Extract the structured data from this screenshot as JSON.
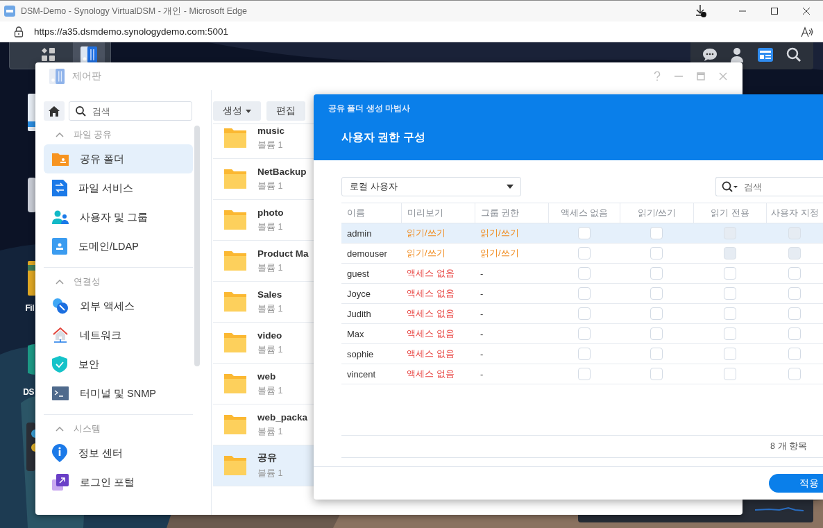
{
  "browser": {
    "title": "DSM-Demo - Synology VirtualDSM - 개인 - Microsoft Edge",
    "url": "https://a35.dsmdemo.synologydemo.com:5001"
  },
  "desktop": {
    "icon_labels": [
      "Fil",
      "DS"
    ]
  },
  "control_panel": {
    "title": "제어판",
    "search_placeholder": "검색",
    "sections": [
      {
        "title": "파일 공유",
        "expanded": true,
        "items": [
          {
            "label": "공유 폴더",
            "selected": true
          },
          {
            "label": "파일 서비스",
            "selected": false
          },
          {
            "label": "사용자 및 그룹",
            "selected": false
          },
          {
            "label": "도메인/LDAP",
            "selected": false
          }
        ]
      },
      {
        "title": "연결성",
        "expanded": true,
        "items": [
          {
            "label": "외부 액세스",
            "selected": false
          },
          {
            "label": "네트워크",
            "selected": false
          },
          {
            "label": "보안",
            "selected": false
          },
          {
            "label": "터미널 및 SNMP",
            "selected": false
          }
        ]
      },
      {
        "title": "시스템",
        "expanded": true,
        "items": [
          {
            "label": "정보 센터",
            "selected": false
          },
          {
            "label": "로그인 포털",
            "selected": false
          }
        ]
      }
    ],
    "toolbar": [
      {
        "label": "생성",
        "dropdown": true
      },
      {
        "label": "편집",
        "dropdown": false
      }
    ],
    "folders": [
      {
        "name": "music",
        "volume": "볼륨 1",
        "selected": false
      },
      {
        "name": "NetBackup",
        "volume": "볼륨 1",
        "selected": false
      },
      {
        "name": "photo",
        "volume": "볼륨 1",
        "selected": false
      },
      {
        "name": "Product Ma",
        "volume": "볼륨 1",
        "selected": false
      },
      {
        "name": "Sales",
        "volume": "볼륨 1",
        "selected": false
      },
      {
        "name": "video",
        "volume": "볼륨 1",
        "selected": false
      },
      {
        "name": "web",
        "volume": "볼륨 1",
        "selected": false
      },
      {
        "name": "web_packa",
        "volume": "볼륨 1",
        "selected": false
      },
      {
        "name": "공유",
        "volume": "볼륨 1",
        "selected": true
      }
    ]
  },
  "wizard": {
    "title": "공유 폴더 생성 마법사",
    "heading": "사용자 권한 구성",
    "user_type": "로컬 사용자",
    "search_placeholder": "검색",
    "columns": [
      "이름",
      "미리보기",
      "그룹 권한",
      "액세스 없음",
      "읽기/쓰기",
      "읽기 전용",
      "사용자 지정"
    ],
    "rows": [
      {
        "name": "admin",
        "selected": true,
        "preview": {
          "text": "읽기/쓰기",
          "kind": "read_write"
        },
        "group": {
          "text": "읽기/쓰기",
          "kind": "read_write"
        },
        "checks": [
          {
            "checked": false,
            "disabled": false
          },
          {
            "checked": false,
            "disabled": false
          },
          {
            "checked": false,
            "disabled": true
          },
          {
            "checked": false,
            "disabled": true
          }
        ]
      },
      {
        "name": "demouser",
        "selected": false,
        "preview": {
          "text": "읽기/쓰기",
          "kind": "read_write"
        },
        "group": {
          "text": "읽기/쓰기",
          "kind": "read_write"
        },
        "checks": [
          {
            "checked": false,
            "disabled": false
          },
          {
            "checked": false,
            "disabled": false
          },
          {
            "checked": false,
            "disabled": true
          },
          {
            "checked": false,
            "disabled": true
          }
        ]
      },
      {
        "name": "guest",
        "selected": false,
        "preview": {
          "text": "액세스 없음",
          "kind": "no_access"
        },
        "group": {
          "text": "-",
          "kind": "plain"
        },
        "checks": [
          {
            "checked": false,
            "disabled": false
          },
          {
            "checked": false,
            "disabled": false
          },
          {
            "checked": false,
            "disabled": false
          },
          {
            "checked": false,
            "disabled": false
          }
        ]
      },
      {
        "name": "Joyce",
        "selected": false,
        "preview": {
          "text": "액세스 없음",
          "kind": "no_access"
        },
        "group": {
          "text": "-",
          "kind": "plain"
        },
        "checks": [
          {
            "checked": false,
            "disabled": false
          },
          {
            "checked": false,
            "disabled": false
          },
          {
            "checked": false,
            "disabled": false
          },
          {
            "checked": false,
            "disabled": false
          }
        ]
      },
      {
        "name": "Judith",
        "selected": false,
        "preview": {
          "text": "액세스 없음",
          "kind": "no_access"
        },
        "group": {
          "text": "-",
          "kind": "plain"
        },
        "checks": [
          {
            "checked": false,
            "disabled": false
          },
          {
            "checked": false,
            "disabled": false
          },
          {
            "checked": false,
            "disabled": false
          },
          {
            "checked": false,
            "disabled": false
          }
        ]
      },
      {
        "name": "Max",
        "selected": false,
        "preview": {
          "text": "액세스 없음",
          "kind": "no_access"
        },
        "group": {
          "text": "-",
          "kind": "plain"
        },
        "checks": [
          {
            "checked": false,
            "disabled": false
          },
          {
            "checked": false,
            "disabled": false
          },
          {
            "checked": false,
            "disabled": false
          },
          {
            "checked": false,
            "disabled": false
          }
        ]
      },
      {
        "name": "sophie",
        "selected": false,
        "preview": {
          "text": "액세스 없음",
          "kind": "no_access"
        },
        "group": {
          "text": "-",
          "kind": "plain"
        },
        "checks": [
          {
            "checked": false,
            "disabled": false
          },
          {
            "checked": false,
            "disabled": false
          },
          {
            "checked": false,
            "disabled": false
          },
          {
            "checked": false,
            "disabled": false
          }
        ]
      },
      {
        "name": "vincent",
        "selected": false,
        "preview": {
          "text": "액세스 없음",
          "kind": "no_access"
        },
        "group": {
          "text": "-",
          "kind": "plain"
        },
        "checks": [
          {
            "checked": false,
            "disabled": false
          },
          {
            "checked": false,
            "disabled": false
          },
          {
            "checked": false,
            "disabled": false
          },
          {
            "checked": false,
            "disabled": false
          }
        ]
      }
    ],
    "count": "8 개 항목",
    "apply": "적용"
  }
}
